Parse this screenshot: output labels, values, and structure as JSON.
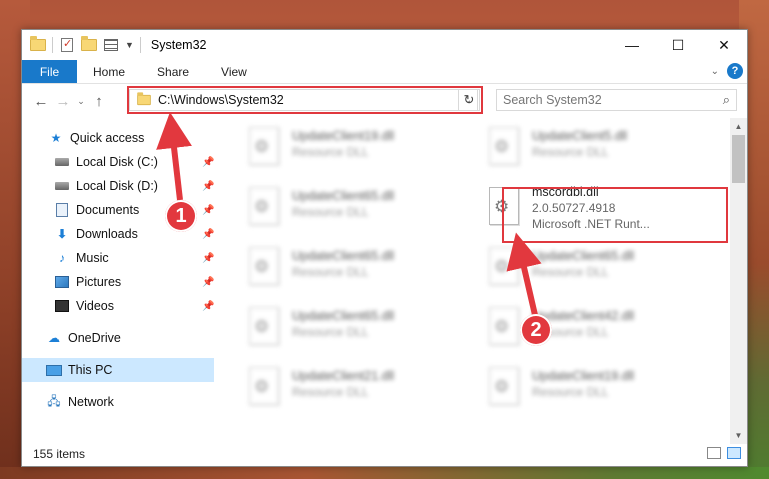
{
  "window": {
    "title": "System32",
    "controls": {
      "minimize": "—",
      "maximize": "☐",
      "close": "✕"
    }
  },
  "ribbon": {
    "tabs": [
      "File",
      "Home",
      "Share",
      "View"
    ],
    "help": "?"
  },
  "address": {
    "path": "C:\\Windows\\System32",
    "refresh": "↻",
    "dropdown": "⌄"
  },
  "search": {
    "placeholder": "Search System32"
  },
  "sidebar": {
    "items": [
      {
        "label": "Quick access",
        "icon": "star-icon",
        "pinned": false,
        "selected": false
      },
      {
        "label": "Local Disk (C:)",
        "icon": "disk-icon",
        "pinned": true,
        "selected": false
      },
      {
        "label": "Local Disk (D:)",
        "icon": "disk-icon",
        "pinned": true,
        "selected": false
      },
      {
        "label": "Documents",
        "icon": "documents-icon",
        "pinned": true,
        "selected": false
      },
      {
        "label": "Downloads",
        "icon": "downloads-icon",
        "pinned": true,
        "selected": false
      },
      {
        "label": "Music",
        "icon": "music-icon",
        "pinned": true,
        "selected": false
      },
      {
        "label": "Pictures",
        "icon": "pictures-icon",
        "pinned": true,
        "selected": false
      },
      {
        "label": "Videos",
        "icon": "videos-icon",
        "pinned": true,
        "selected": false
      },
      {
        "label": "OneDrive",
        "icon": "onedrive-icon",
        "pinned": false,
        "selected": false
      },
      {
        "label": "This PC",
        "icon": "this-pc-icon",
        "pinned": false,
        "selected": true
      },
      {
        "label": "Network",
        "icon": "network-icon",
        "pinned": false,
        "selected": false
      }
    ]
  },
  "files": [
    {
      "name": "UpdateClient19.dll",
      "sub": "Resource DLL",
      "blurred": true
    },
    {
      "name": "UpdateClient5.dll",
      "sub": "Resource DLL",
      "blurred": true
    },
    {
      "name": "UpdateClient65.dll",
      "sub": "Resource DLL",
      "blurred": true
    },
    {
      "name": "mscordbi.dll",
      "version": "2.0.50727.4918",
      "sub": "Microsoft .NET Runt...",
      "blurred": false
    },
    {
      "name": "UpdateClient65.dll",
      "sub": "Resource DLL",
      "blurred": true
    },
    {
      "name": "UpdateClient65.dll",
      "sub": "Resource DLL",
      "blurred": true
    },
    {
      "name": "UpdateClient65.dll",
      "sub": "Resource DLL",
      "blurred": true
    },
    {
      "name": "UpdateClient42.dll",
      "sub": "Resource DLL",
      "blurred": true
    },
    {
      "name": "UpdateClient21.dll",
      "sub": "Resource DLL",
      "blurred": true
    },
    {
      "name": "UpdateClient19.dll",
      "sub": "Resource DLL",
      "blurred": true
    }
  ],
  "status": {
    "item_count": "155 items"
  },
  "annotations": {
    "callout_1": "1",
    "callout_2": "2",
    "color": "#e2383e"
  },
  "colors": {
    "accent": "#1979ca",
    "selected_bg": "#cce8ff",
    "highlight_red": "#e0383e"
  }
}
